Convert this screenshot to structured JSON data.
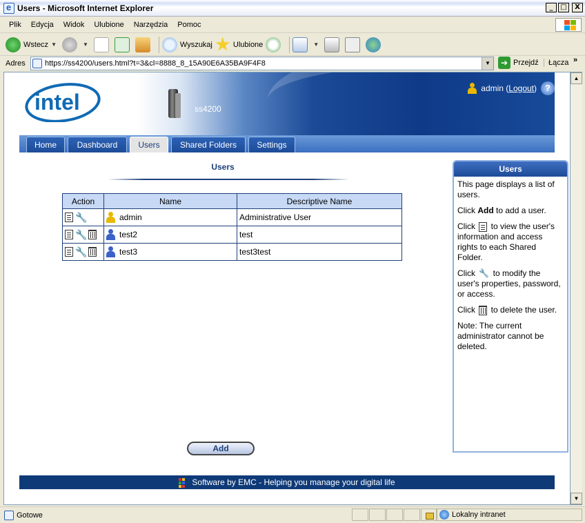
{
  "window": {
    "title": "Users - Microsoft Internet Explorer",
    "min": "_",
    "max": "□",
    "close": "X"
  },
  "menu": [
    "Plik",
    "Edycja",
    "Widok",
    "Ulubione",
    "Narzędzia",
    "Pomoc"
  ],
  "toolbar": {
    "back": "Wstecz",
    "search": "Wyszukaj",
    "favorites": "Ulubione"
  },
  "address": {
    "label": "Adres",
    "url": "https://ss4200/users.html?t=3&cl=8888_8_15A90E6A35BA9F4F8",
    "go": "Przejdź",
    "links": "Łącza",
    "links_chevron": "»"
  },
  "header": {
    "device_name": "ss4200",
    "user": "admin",
    "logout": "Logout",
    "help": "?"
  },
  "tabs": [
    "Home",
    "Dashboard",
    "Users",
    "Shared Folders",
    "Settings"
  ],
  "active_tab": "Users",
  "section_title": "Users",
  "table": {
    "headers": [
      "Action",
      "Name",
      "Descriptive Name"
    ],
    "rows": [
      {
        "name": "admin",
        "descriptive": "Administrative User",
        "role": "admin"
      },
      {
        "name": "test2",
        "descriptive": "test",
        "role": "user"
      },
      {
        "name": "test3",
        "descriptive": "test3test",
        "role": "user"
      }
    ]
  },
  "add_button": "Add",
  "footer": "Software by EMC - Helping you manage your digital life",
  "help": {
    "title": "Users",
    "p1": "This page displays a list of users.",
    "p2_pre": "Click ",
    "p2_bold": "Add",
    "p2_post": " to add a user.",
    "p3_pre": "Click ",
    "p3_post": " to view the user's information and access rights to each Shared Folder.",
    "p4_pre": "Click ",
    "p4_post": " to modify the user's properties, password, or access.",
    "p5_pre": "Click ",
    "p5_post": " to delete the user.",
    "p6": "Note: The current administrator cannot be deleted."
  },
  "status": {
    "text": "Gotowe",
    "zone": "Lokalny intranet"
  },
  "colors": {
    "accent": "#1d3f7a",
    "header_dark": "#0f3a88",
    "table_header": "#c7d9f5",
    "admin_icon": "#e8b800",
    "user_icon": "#3a62c8"
  }
}
